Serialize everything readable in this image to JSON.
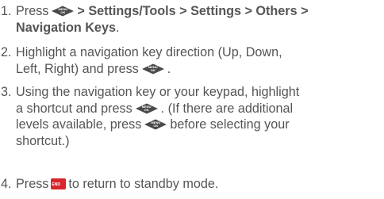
{
  "steps": [
    {
      "number": "1.",
      "press": "Press",
      "path": [
        "> Settings/Tools",
        "> Settings",
        "> Others >"
      ],
      "path_end": "Navigation Keys",
      "end": "."
    },
    {
      "number": "2.",
      "line1": "Highlight a navigation key direction (Up, Down,",
      "line2a": "Left, Right) and press",
      "line2b": "."
    },
    {
      "number": "3.",
      "line1": "Using the navigation key or your keypad, highlight",
      "line2a": "a shortcut and press",
      "line2b": ". (If there are additional",
      "line3a": "levels available, press",
      "line3b": "before selecting your",
      "line4": "shortcut.)"
    },
    {
      "number": "4.",
      "press": "Press",
      "rest": "to return to standby mode."
    }
  ],
  "icons": {
    "menu_ok_key": {
      "line1": "MENU",
      "line2": "OK",
      "color": "#4a4a4a"
    },
    "end_key": {
      "label": "END",
      "color": "#d7262c"
    }
  }
}
